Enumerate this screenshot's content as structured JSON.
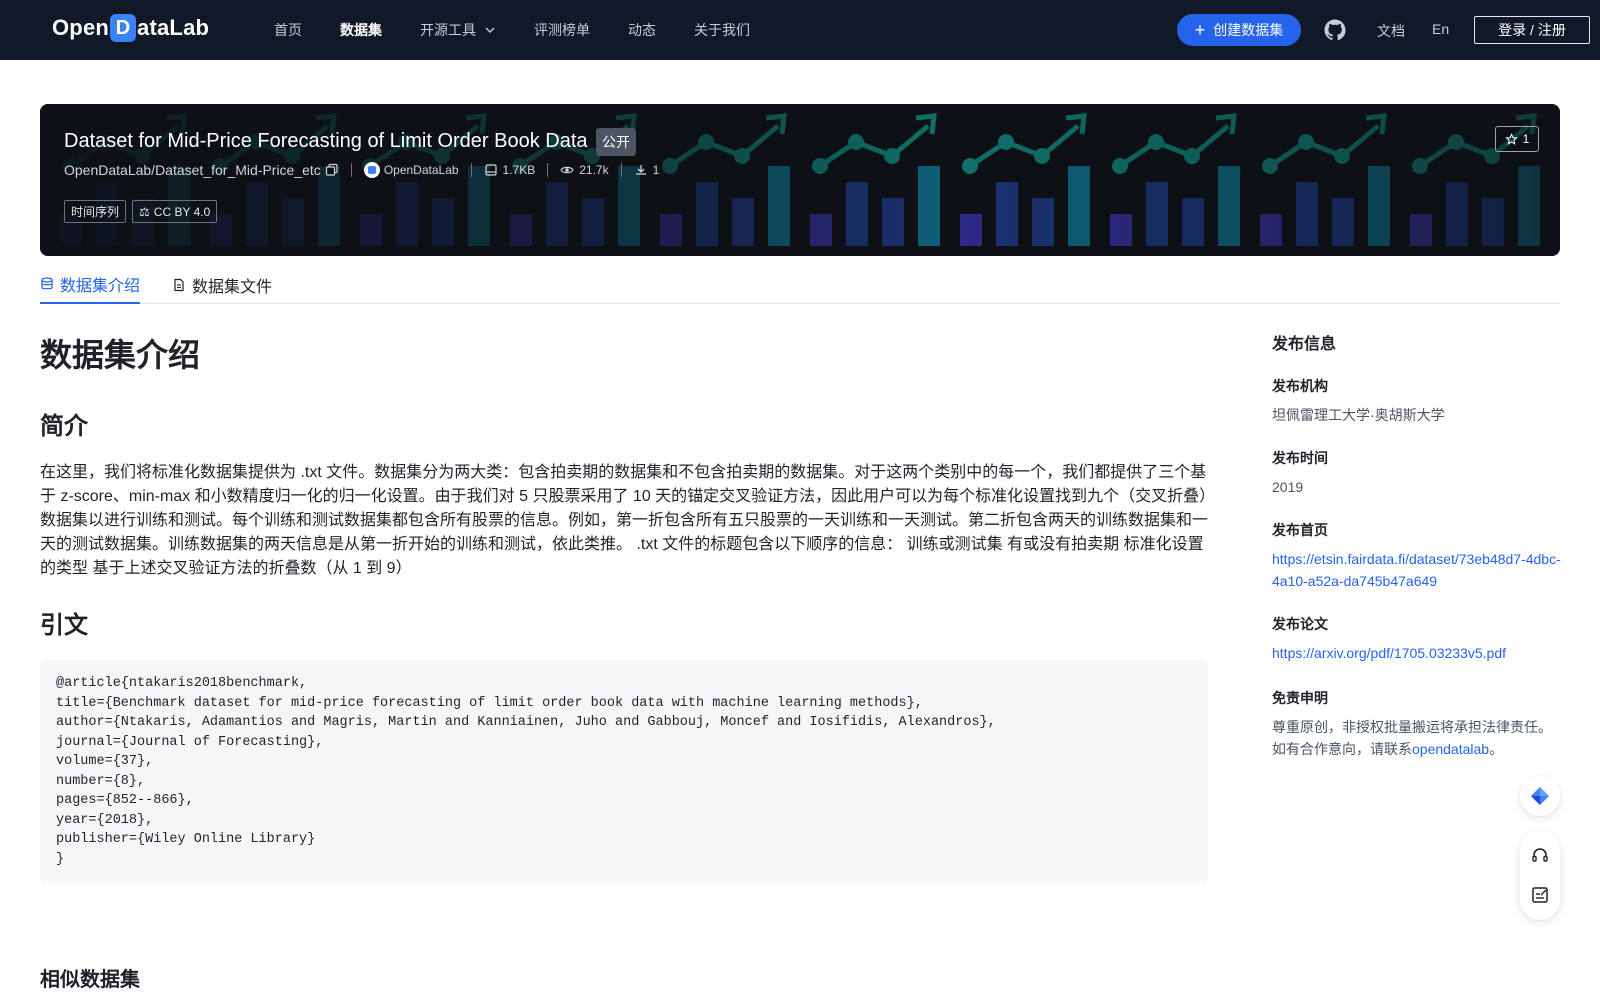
{
  "nav": {
    "logo_text_before": "Open",
    "logo_mark": "D",
    "logo_text_after": "ataLab",
    "items": [
      {
        "label": "首页",
        "active": false
      },
      {
        "label": "数据集",
        "active": true
      },
      {
        "label": "开源工具",
        "active": false,
        "dropdown": true
      },
      {
        "label": "评测榜单",
        "active": false
      },
      {
        "label": "动态",
        "active": false
      },
      {
        "label": "关于我们",
        "active": false
      }
    ],
    "create_label": "创建数据集",
    "doc_label": "文档",
    "lang_label": "En",
    "login_label": "登录 / 注册",
    "icons": [
      "chevron-down-icon",
      "plus-icon",
      "github-icon"
    ]
  },
  "dataset": {
    "title": "Dataset for Mid-Price Forecasting of Limit Order Book Data",
    "visibility": "公开",
    "repo_path": "OpenDataLab/Dataset_for_Mid-Price_etc",
    "org": "OpenDataLab",
    "size": "1.7KB",
    "views": "21.7k",
    "downloads": "1",
    "tags": [
      "时间序列",
      "CC BY 4.0"
    ],
    "stars": "1"
  },
  "tabs": [
    "数据集介绍",
    "数据集文件"
  ],
  "content": {
    "heading": "数据集介绍",
    "intro_heading": "简介",
    "intro_text": "在这里，我们将标准化数据集提供为 .txt 文件。数据集分为两大类：包含拍卖期的数据集和不包含拍卖期的数据集。对于这两个类别中的每一个，我们都提供了三个基于 z-score、min-max 和小数精度归一化的归一化设置。由于我们对 5 只股票采用了 10 天的锚定交叉验证方法，因此用户可以为每个标准化设置找到九个（交叉折叠）数据集以进行训练和测试。每个训练和测试数据集都包含所有股票的信息。例如，第一折包含所有五只股票的一天训练和一天测试。第二折包含两天的训练数据集和一天的测试数据集。训练数据集的两天信息是从第一折开始的训练和测试，依此类推。 .txt 文件的标题包含以下顺序的信息： 训练或测试集 有或没有拍卖期 标准化设置的类型 基于上述交叉验证方法的折叠数（从 1 到 9）",
    "citation_heading": "引文",
    "citation": "@article{ntakaris2018benchmark,\ntitle={Benchmark dataset for mid-price forecasting of limit order book data with machine learning methods},\nauthor={Ntakaris, Adamantios and Magris, Martin and Kanniainen, Juho and Gabbouj, Moncef and Iosifidis, Alexandros},\njournal={Journal of Forecasting},\nvolume={37},\nnumber={8},\npages={852--866},\nyear={2018},\npublisher={Wiley Online Library}\n}",
    "similar_heading": "相似数据集"
  },
  "sidebar": {
    "title": "发布信息",
    "org_label": "发布机构",
    "org_value": "坦佩雷理工大学·奥胡斯大学",
    "time_label": "发布时间",
    "time_value": "2019",
    "home_label": "发布首页",
    "home_url": "https://etsin.fairdata.fi/dataset/73eb48d7-4dbc-4a10-a52a-da745b47a649",
    "paper_label": "发布论文",
    "paper_url": "https://arxiv.org/pdf/1705.03233v5.pdf",
    "disclaimer_label": "免责申明",
    "disclaimer_text_1": "尊重原创，非授权批量搬运将承担法律责任。如有合作意向，请联系",
    "disclaimer_link": "opendatalab",
    "disclaimer_text_2": "。"
  },
  "colors": {
    "nav_bg": "#111827",
    "accent": "#2563eb",
    "banner_bg": "#0d1014"
  }
}
